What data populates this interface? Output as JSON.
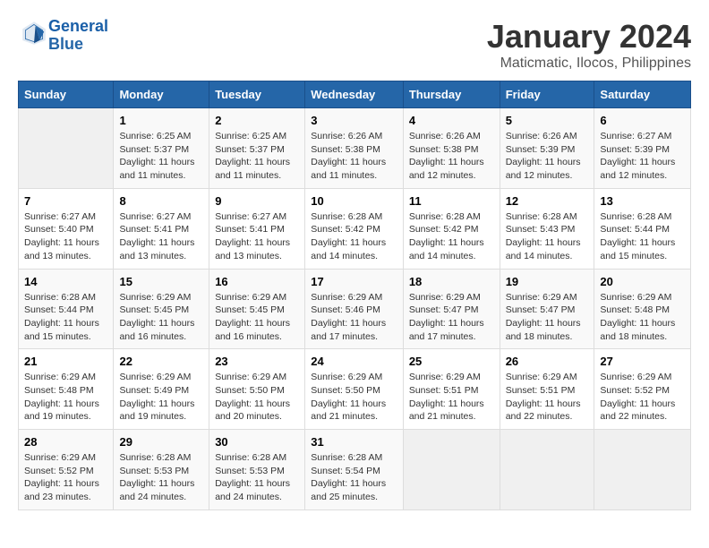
{
  "header": {
    "logo_line1": "General",
    "logo_line2": "Blue",
    "month": "January 2024",
    "location": "Maticmatic, Ilocos, Philippines"
  },
  "weekdays": [
    "Sunday",
    "Monday",
    "Tuesday",
    "Wednesday",
    "Thursday",
    "Friday",
    "Saturday"
  ],
  "weeks": [
    [
      {
        "day": "",
        "info": ""
      },
      {
        "day": "1",
        "info": "Sunrise: 6:25 AM\nSunset: 5:37 PM\nDaylight: 11 hours and 11 minutes."
      },
      {
        "day": "2",
        "info": "Sunrise: 6:25 AM\nSunset: 5:37 PM\nDaylight: 11 hours and 11 minutes."
      },
      {
        "day": "3",
        "info": "Sunrise: 6:26 AM\nSunset: 5:38 PM\nDaylight: 11 hours and 11 minutes."
      },
      {
        "day": "4",
        "info": "Sunrise: 6:26 AM\nSunset: 5:38 PM\nDaylight: 11 hours and 12 minutes."
      },
      {
        "day": "5",
        "info": "Sunrise: 6:26 AM\nSunset: 5:39 PM\nDaylight: 11 hours and 12 minutes."
      },
      {
        "day": "6",
        "info": "Sunrise: 6:27 AM\nSunset: 5:39 PM\nDaylight: 11 hours and 12 minutes."
      }
    ],
    [
      {
        "day": "7",
        "info": "Sunrise: 6:27 AM\nSunset: 5:40 PM\nDaylight: 11 hours and 13 minutes."
      },
      {
        "day": "8",
        "info": "Sunrise: 6:27 AM\nSunset: 5:41 PM\nDaylight: 11 hours and 13 minutes."
      },
      {
        "day": "9",
        "info": "Sunrise: 6:27 AM\nSunset: 5:41 PM\nDaylight: 11 hours and 13 minutes."
      },
      {
        "day": "10",
        "info": "Sunrise: 6:28 AM\nSunset: 5:42 PM\nDaylight: 11 hours and 14 minutes."
      },
      {
        "day": "11",
        "info": "Sunrise: 6:28 AM\nSunset: 5:42 PM\nDaylight: 11 hours and 14 minutes."
      },
      {
        "day": "12",
        "info": "Sunrise: 6:28 AM\nSunset: 5:43 PM\nDaylight: 11 hours and 14 minutes."
      },
      {
        "day": "13",
        "info": "Sunrise: 6:28 AM\nSunset: 5:44 PM\nDaylight: 11 hours and 15 minutes."
      }
    ],
    [
      {
        "day": "14",
        "info": "Sunrise: 6:28 AM\nSunset: 5:44 PM\nDaylight: 11 hours and 15 minutes."
      },
      {
        "day": "15",
        "info": "Sunrise: 6:29 AM\nSunset: 5:45 PM\nDaylight: 11 hours and 16 minutes."
      },
      {
        "day": "16",
        "info": "Sunrise: 6:29 AM\nSunset: 5:45 PM\nDaylight: 11 hours and 16 minutes."
      },
      {
        "day": "17",
        "info": "Sunrise: 6:29 AM\nSunset: 5:46 PM\nDaylight: 11 hours and 17 minutes."
      },
      {
        "day": "18",
        "info": "Sunrise: 6:29 AM\nSunset: 5:47 PM\nDaylight: 11 hours and 17 minutes."
      },
      {
        "day": "19",
        "info": "Sunrise: 6:29 AM\nSunset: 5:47 PM\nDaylight: 11 hours and 18 minutes."
      },
      {
        "day": "20",
        "info": "Sunrise: 6:29 AM\nSunset: 5:48 PM\nDaylight: 11 hours and 18 minutes."
      }
    ],
    [
      {
        "day": "21",
        "info": "Sunrise: 6:29 AM\nSunset: 5:48 PM\nDaylight: 11 hours and 19 minutes."
      },
      {
        "day": "22",
        "info": "Sunrise: 6:29 AM\nSunset: 5:49 PM\nDaylight: 11 hours and 19 minutes."
      },
      {
        "day": "23",
        "info": "Sunrise: 6:29 AM\nSunset: 5:50 PM\nDaylight: 11 hours and 20 minutes."
      },
      {
        "day": "24",
        "info": "Sunrise: 6:29 AM\nSunset: 5:50 PM\nDaylight: 11 hours and 21 minutes."
      },
      {
        "day": "25",
        "info": "Sunrise: 6:29 AM\nSunset: 5:51 PM\nDaylight: 11 hours and 21 minutes."
      },
      {
        "day": "26",
        "info": "Sunrise: 6:29 AM\nSunset: 5:51 PM\nDaylight: 11 hours and 22 minutes."
      },
      {
        "day": "27",
        "info": "Sunrise: 6:29 AM\nSunset: 5:52 PM\nDaylight: 11 hours and 22 minutes."
      }
    ],
    [
      {
        "day": "28",
        "info": "Sunrise: 6:29 AM\nSunset: 5:52 PM\nDaylight: 11 hours and 23 minutes."
      },
      {
        "day": "29",
        "info": "Sunrise: 6:28 AM\nSunset: 5:53 PM\nDaylight: 11 hours and 24 minutes."
      },
      {
        "day": "30",
        "info": "Sunrise: 6:28 AM\nSunset: 5:53 PM\nDaylight: 11 hours and 24 minutes."
      },
      {
        "day": "31",
        "info": "Sunrise: 6:28 AM\nSunset: 5:54 PM\nDaylight: 11 hours and 25 minutes."
      },
      {
        "day": "",
        "info": ""
      },
      {
        "day": "",
        "info": ""
      },
      {
        "day": "",
        "info": ""
      }
    ]
  ]
}
